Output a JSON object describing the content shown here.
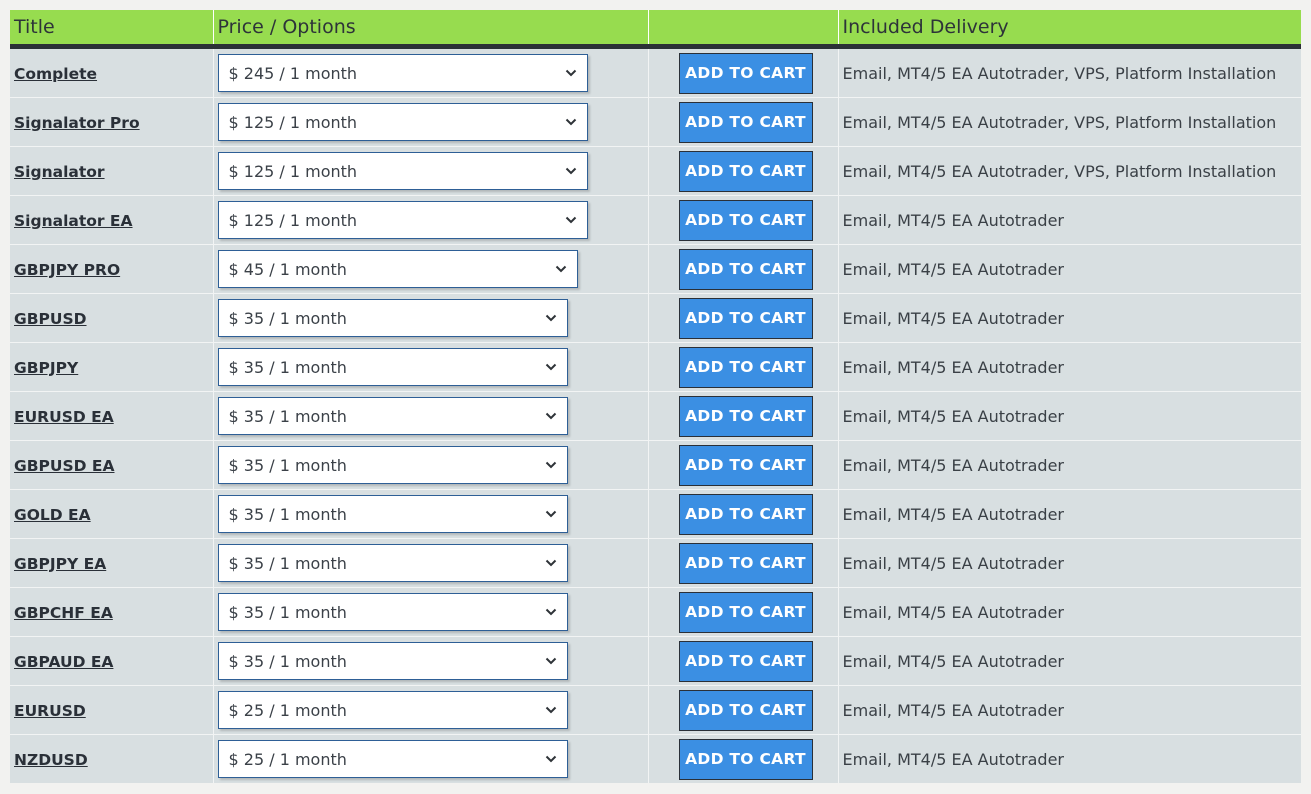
{
  "header": {
    "title": "Title",
    "price": "Price / Options",
    "cart": "",
    "delivery": "Included Delivery"
  },
  "colors": {
    "header_bg": "#97dc4f",
    "header_border": "#2b3036",
    "row_bg": "#d8dfe1",
    "button_bg": "#3b8fe3",
    "select_border": "#2e5f96"
  },
  "cart_label": "ADD TO CART",
  "rows": [
    {
      "title": "Complete",
      "price": "$ 245 / 1 month",
      "delivery": "Email, MT4/5 EA Autotrader, VPS, Platform Installation"
    },
    {
      "title": "Signalator Pro",
      "price": "$ 125 / 1 month",
      "delivery": "Email, MT4/5 EA Autotrader, VPS, Platform Installation"
    },
    {
      "title": "Signalator",
      "price": "$ 125 / 1 month",
      "delivery": "Email, MT4/5 EA Autotrader, VPS, Platform Installation"
    },
    {
      "title": "Signalator EA",
      "price": "$ 125 / 1 month",
      "delivery": "Email, MT4/5 EA Autotrader"
    },
    {
      "title": "GBPJPY PRO",
      "price": "$ 45 / 1 month",
      "delivery": "Email, MT4/5 EA Autotrader"
    },
    {
      "title": "GBPUSD",
      "price": "$ 35 / 1 month",
      "delivery": "Email, MT4/5 EA Autotrader"
    },
    {
      "title": "GBPJPY",
      "price": "$ 35 / 1 month",
      "delivery": "Email, MT4/5 EA Autotrader"
    },
    {
      "title": "EURUSD EA",
      "price": "$ 35 / 1 month",
      "delivery": "Email, MT4/5 EA Autotrader"
    },
    {
      "title": "GBPUSD EA",
      "price": "$ 35 / 1 month",
      "delivery": "Email, MT4/5 EA Autotrader"
    },
    {
      "title": "GOLD EA",
      "price": "$ 35 / 1 month",
      "delivery": "Email, MT4/5 EA Autotrader"
    },
    {
      "title": "GBPJPY EA",
      "price": "$ 35 / 1 month",
      "delivery": "Email, MT4/5 EA Autotrader"
    },
    {
      "title": "GBPCHF EA",
      "price": "$ 35 / 1 month",
      "delivery": "Email, MT4/5 EA Autotrader"
    },
    {
      "title": "GBPAUD EA",
      "price": "$ 35 / 1 month",
      "delivery": "Email, MT4/5 EA Autotrader"
    },
    {
      "title": "EURUSD",
      "price": "$ 25 / 1 month",
      "delivery": "Email, MT4/5 EA Autotrader"
    },
    {
      "title": "NZDUSD",
      "price": "$ 25 / 1 month",
      "delivery": "Email, MT4/5 EA Autotrader"
    }
  ]
}
